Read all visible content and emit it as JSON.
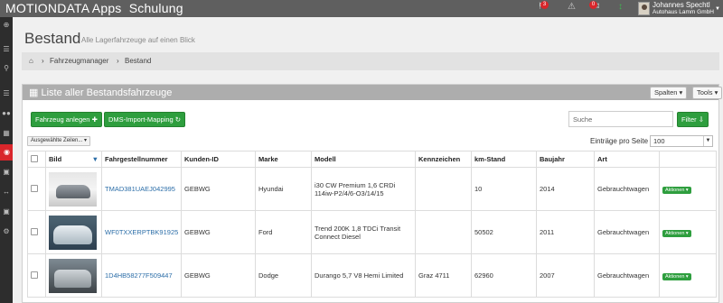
{
  "app": {
    "title": "MOTIONDATA Apps",
    "subtitle": "Schulung"
  },
  "topbar": {
    "notifications_count": "3",
    "messages_count": "0",
    "user_name": "Johannes Spechtl",
    "user_company": "Autohaus Lamm GmbH"
  },
  "sidebar": {
    "icons": [
      "plus-circle-icon",
      "menu-icon",
      "search-icon",
      "list-icon",
      "users-icon",
      "grid-icon",
      "car-icon",
      "calendar-icon",
      "arrows-icon",
      "image-icon",
      "settings-icon"
    ],
    "active": "car-icon"
  },
  "page": {
    "title": "Bestand",
    "subtitle": "Alle Lagerfahrzeuge auf einen Blick"
  },
  "breadcrumb": {
    "level1": "Fahrzeugmanager",
    "level2": "Bestand"
  },
  "panel": {
    "title": "Liste aller Bestandsfahrzeuge",
    "spalten_label": "Spalten",
    "tools_label": "Tools",
    "add_vehicle_label": "Fahrzeug anlegen",
    "dms_import_label": "DMS-Import-Mapping",
    "selected_rows_label": "Ausgewählte Zeilen...",
    "search_placeholder": "Suche",
    "filter_label": "Filter",
    "entries_per_page_label": "Einträge pro Seite",
    "entries_per_page_value": "100"
  },
  "table": {
    "headers": [
      "",
      "Bild",
      "Fahrgestellnummer",
      "Kunden-ID",
      "Marke",
      "Modell",
      "Kennzeichen",
      "km-Stand",
      "Baujahr",
      "Art",
      ""
    ],
    "rows": [
      {
        "vin": "TMAD381UAEJ042995",
        "customer_id": "GEBWG",
        "brand": "Hyundai",
        "model": "i30 CW Premium 1,6 CRDi 114iw-P2/4/6-O3/14/15",
        "plate": "",
        "km": "10",
        "year": "2014",
        "type": "Gebrauchtwagen",
        "action": "Aktionen"
      },
      {
        "vin": "WF0TXXERPTBK91925",
        "customer_id": "GEBWG",
        "brand": "Ford",
        "model": "Trend 200K 1,8 TDCi Transit Connect Diesel",
        "plate": "",
        "km": "50502",
        "year": "2011",
        "type": "Gebrauchtwagen",
        "action": "Aktionen"
      },
      {
        "vin": "1D4HB58277F509447",
        "customer_id": "GEBWG",
        "brand": "Dodge",
        "model": "Durango 5,7 V8 Hemi Limited",
        "plate": "Graz 4711",
        "km": "62960",
        "year": "2007",
        "type": "Gebrauchtwagen",
        "action": "Aktionen"
      }
    ]
  }
}
